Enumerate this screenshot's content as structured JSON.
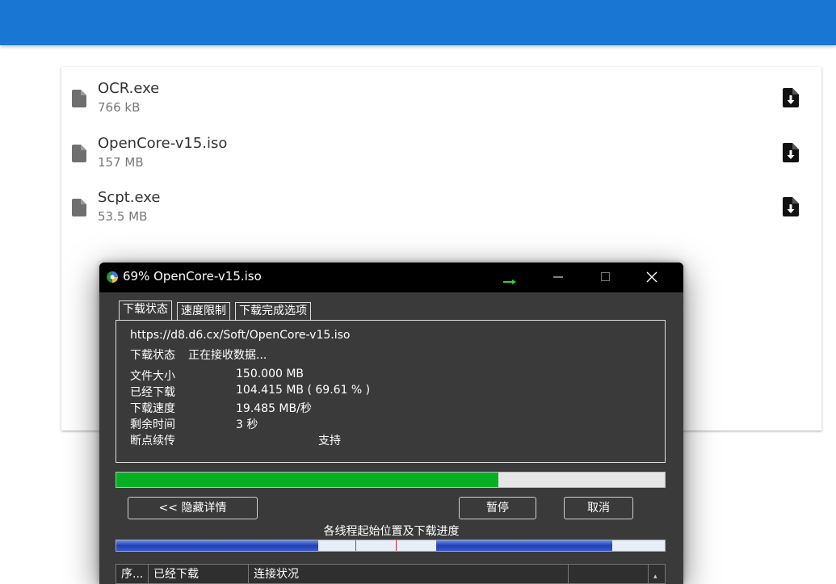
{
  "files": [
    {
      "name": "OCR.exe",
      "size": "766 kB"
    },
    {
      "name": "OpenCore-v15.iso",
      "size": "157 MB"
    },
    {
      "name": "Scpt.exe",
      "size": "53.5 MB"
    }
  ],
  "icons": {
    "file": "file-icon",
    "download": "file-download-icon"
  },
  "colors": {
    "topbar": "#1976d2",
    "progress": "#06b025",
    "window_title": "#000000"
  },
  "dialog": {
    "title": "69% OpenCore-v15.iso",
    "tabs": [
      "下载状态",
      "速度限制",
      "下载完成选项"
    ],
    "url": "https://d8.d6.cx/Soft/OpenCore-v15.iso",
    "status_label": "下载状态",
    "status_value": "正在接收数据...",
    "details": [
      {
        "label": "文件大小",
        "value": "150.000  MB"
      },
      {
        "label": "已经下载",
        "value": "104.415  MB  ( 69.61 % )"
      },
      {
        "label": "下载速度",
        "value": "19.485  MB/秒"
      },
      {
        "label": "剩余时间",
        "value": "3 秒"
      },
      {
        "label": "断点续传",
        "value": "支持"
      }
    ],
    "progress_fraction": 0.6961,
    "buttons": {
      "hide_details": "<< 隐藏详情",
      "pause": "暂停",
      "cancel": "取消"
    },
    "threads_caption": "各线程起始位置及下载进度",
    "columns": [
      "序...",
      "已经下载",
      "连接状况",
      ""
    ]
  }
}
